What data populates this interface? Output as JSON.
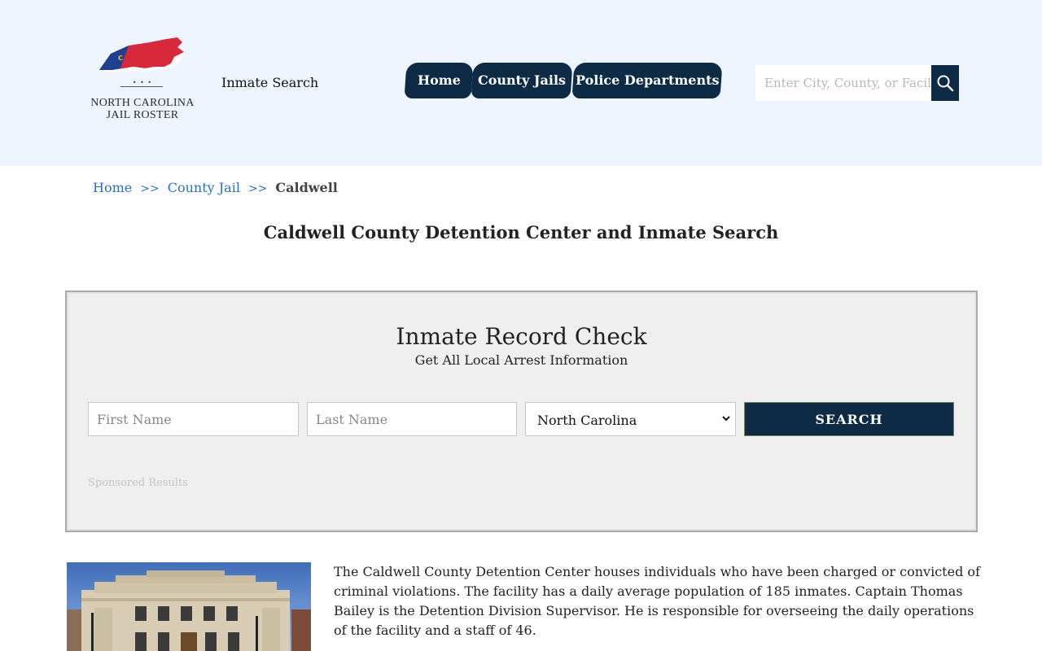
{
  "header": {
    "logo_text_line1": "NORTH CAROLINA",
    "logo_text_line2": "JAIL ROSTER",
    "logo_dots": "• • •",
    "site_link": "Inmate Search"
  },
  "nav": {
    "items": [
      {
        "label": "Home"
      },
      {
        "label": "County Jails"
      },
      {
        "label": "Police Departments"
      }
    ]
  },
  "search": {
    "placeholder": "Enter City, County, or Facility"
  },
  "breadcrumb": {
    "items": [
      "Home",
      "County Jail"
    ],
    "separator": ">>",
    "current": "Caldwell"
  },
  "page_title": "Caldwell County Detention Center and Inmate Search",
  "record_check": {
    "title": "Inmate Record Check",
    "subtitle": "Get All Local Arrest Information",
    "first_name_placeholder": "First Name",
    "last_name_placeholder": "Last Name",
    "state_selected": "North Carolina",
    "search_label": "SEARCH",
    "sponsored": "Sponsored Results"
  },
  "content": {
    "description": "The Caldwell County Detention Center houses individuals who have been charged or convicted of criminal violations. The facility has a daily average population of 185 inmates. Captain Thomas Bailey is the Detention Division Supervisor. He is responsible for overseeing the daily operations of the facility and a staff of 46."
  },
  "colors": {
    "header_bg": "#eef5ff",
    "nav_bg": "#0d2b45",
    "link": "#2a6fc9",
    "panel_bg": "#efefef"
  }
}
